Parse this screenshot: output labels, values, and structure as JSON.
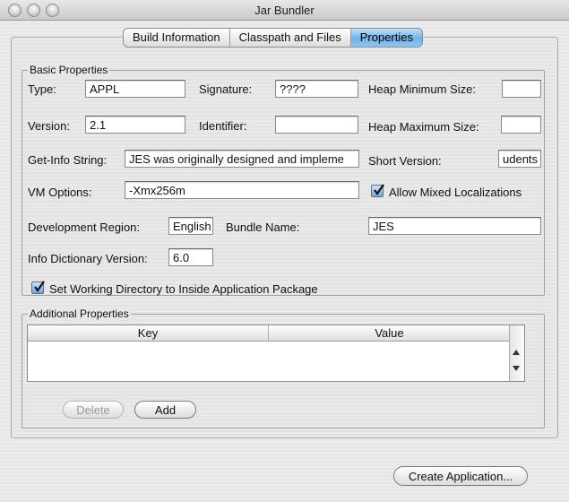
{
  "window": {
    "title": "Jar Bundler"
  },
  "tabs": [
    {
      "label": "Build Information"
    },
    {
      "label": "Classpath and Files"
    },
    {
      "label": "Properties"
    }
  ],
  "basic": {
    "legend": "Basic Properties",
    "type_label": "Type:",
    "type_value": "APPL",
    "signature_label": "Signature:",
    "signature_value": "????",
    "heap_min_label": "Heap Minimum Size:",
    "heap_min_value": "",
    "version_label": "Version:",
    "version_value": "2.1",
    "identifier_label": "Identifier:",
    "identifier_value": "",
    "heap_max_label": "Heap Maximum Size:",
    "heap_max_value": "",
    "getinfo_label": "Get-Info String:",
    "getinfo_value": "JES was originally designed and impleme",
    "short_version_label": "Short Version:",
    "short_version_value": "udents",
    "vm_options_label": "VM Options:",
    "vm_options_value": "-Xmx256m",
    "allow_mixed_label": "Allow Mixed Localizations",
    "dev_region_label": "Development Region:",
    "dev_region_value": "English",
    "bundle_name_label": "Bundle Name:",
    "bundle_name_value": "JES",
    "info_dict_label": "Info Dictionary Version:",
    "info_dict_value": "6.0",
    "set_working_dir_label": "Set Working Directory to Inside Application Package"
  },
  "additional": {
    "legend": "Additional Properties",
    "columns": [
      "Key",
      "Value"
    ],
    "delete_label": "Delete",
    "add_label": "Add"
  },
  "create_label": "Create Application..."
}
